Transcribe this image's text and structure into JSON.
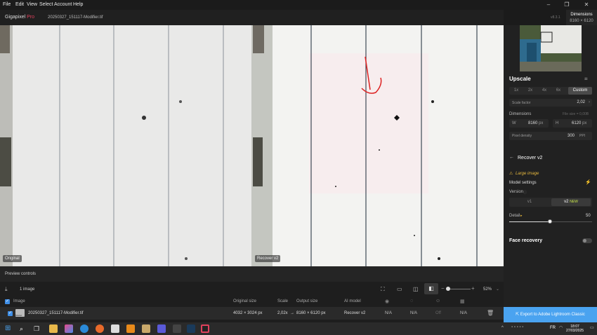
{
  "menubar": {
    "items": [
      "File",
      "Edit",
      "View",
      "Select",
      "Account",
      "Help"
    ]
  },
  "titlebar": {
    "brand_main": "Gigapixel",
    "brand_pro": "Pro",
    "filename": "20250327_151117-Modifier.tif",
    "version": "v8.3.1"
  },
  "dimensions": {
    "label": "Dimensions",
    "value": "8160 × 6120"
  },
  "viewer": {
    "left_label": "Original",
    "right_label": "Recover v2"
  },
  "preview_controls": {
    "label": "Preview controls"
  },
  "batch": {
    "count": "1 image",
    "zoom": "52%",
    "headers": {
      "image": "Image",
      "original_size": "Original size",
      "scale": "Scale",
      "output_size": "Output size",
      "ai_model": "AI model"
    },
    "row": {
      "thumb_label": "Sbeleit",
      "filename": "20250327_151117-Modifier.tif",
      "original_size": "4032 × 3024 px",
      "scale": "2,02x",
      "arrow": "→",
      "output_size": "8160 × 6120 px",
      "ai_model": "Recover v2",
      "c1": "N/A",
      "c2": "N/A",
      "c3": "Off",
      "c4": "N/A"
    }
  },
  "upscale": {
    "title": "Upscale",
    "options": [
      "1x",
      "2x",
      "4x",
      "6x",
      "Custom"
    ],
    "selected": "Custom",
    "scale_factor_label": "Scale factor",
    "scale_factor_value": "2,02",
    "dimensions_label": "Dimensions",
    "file_size_label": "File size = 0,00B",
    "w_label": "W",
    "w_value": "8160",
    "w_unit": "px",
    "h_label": "H",
    "h_value": "6120",
    "h_unit": "px",
    "pixel_density_label": "Pixel density",
    "pixel_density_value": "300",
    "pixel_density_unit": "PPI"
  },
  "model": {
    "title": "Recover v2",
    "warning": "Large image",
    "settings_label": "Model settings",
    "version_label": "Version",
    "versions": [
      "v1",
      "v2"
    ],
    "new_badge": "NEW",
    "detail_label": "Detail",
    "detail_value": "50",
    "face_recovery_label": "Face recovery"
  },
  "export": {
    "label": "Export to Adobe Lightroom Classic"
  },
  "taskbar": {
    "lang": "FR",
    "time": "18:07",
    "date": "27/03/2025"
  },
  "colors": {
    "accent": "#3e8ee6",
    "export_bg": "#4aa3f0",
    "new_badge": "#c8e64a",
    "warning": "#e6b83e"
  }
}
